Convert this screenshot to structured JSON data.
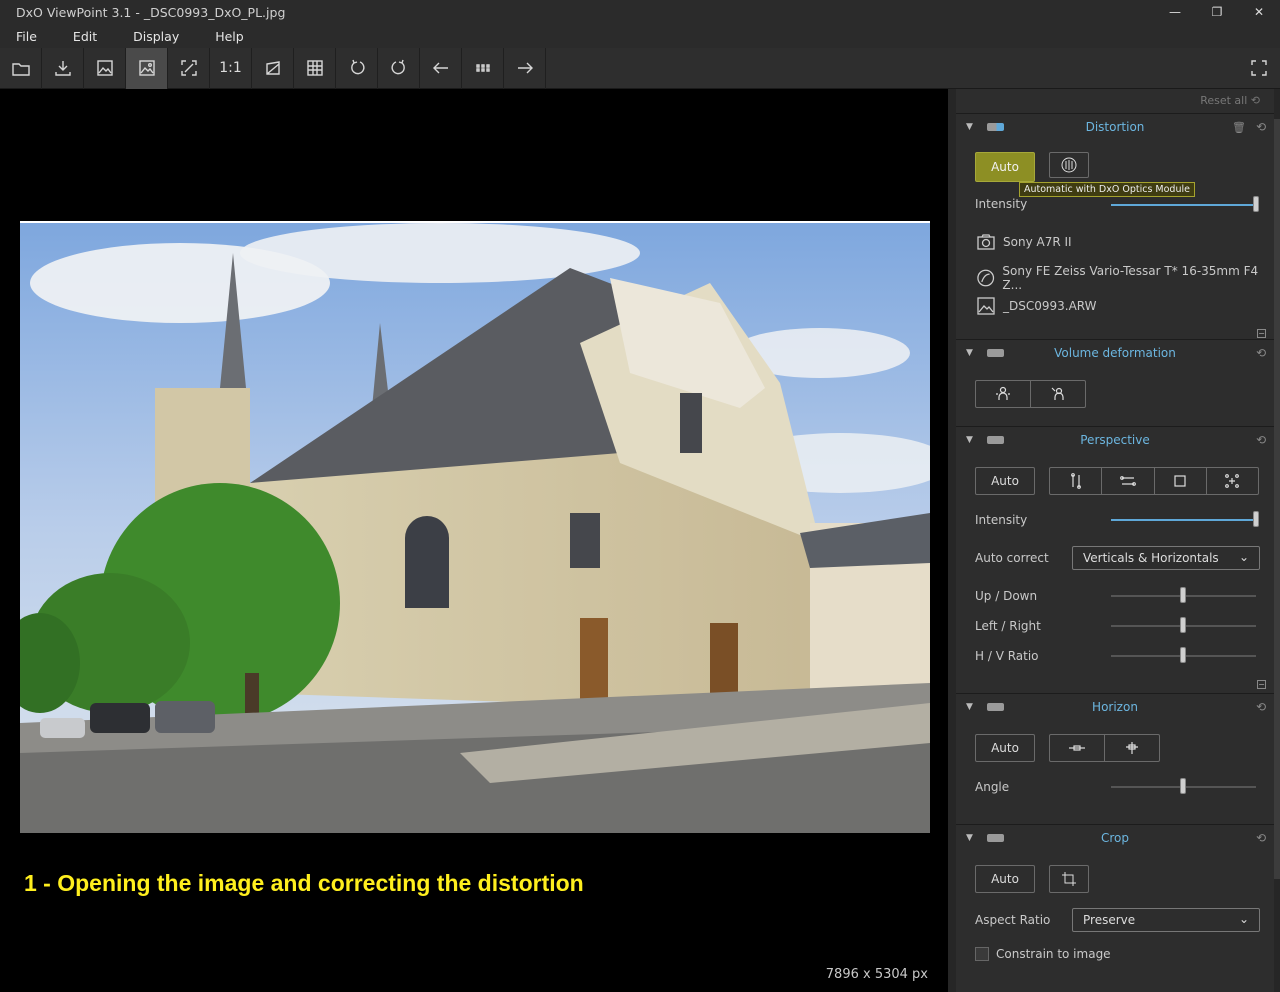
{
  "window": {
    "title": "DxO ViewPoint 3.1 - _DSC0993_DxO_PL.jpg"
  },
  "menu": [
    "File",
    "Edit",
    "Display",
    "Help"
  ],
  "toolbar": {
    "one_to_one": "1:1"
  },
  "viewer": {
    "caption": "1 - Opening the image and correcting the distortion",
    "dimensions": "7896 x 5304 px"
  },
  "panel": {
    "reset_all": "Reset all",
    "distortion": {
      "title": "Distortion",
      "auto": "Auto",
      "tooltip": "Automatic with DxO Optics Module",
      "intensity_label": "Intensity",
      "intensity": 1.0,
      "camera": "Sony A7R II",
      "lens": "Sony FE Zeiss Vario-Tessar T* 16-35mm F4 Z...",
      "file": "_DSC0993.ARW"
    },
    "volume": {
      "title": "Volume deformation"
    },
    "perspective": {
      "title": "Perspective",
      "auto": "Auto",
      "intensity_label": "Intensity",
      "intensity": 1.0,
      "auto_correct_label": "Auto correct",
      "auto_correct_value": "Verticals & Horizontals",
      "up_down_label": "Up / Down",
      "left_right_label": "Left / Right",
      "hv_ratio_label": "H / V Ratio",
      "up_down": 0.5,
      "left_right": 0.5,
      "hv_ratio": 0.5
    },
    "horizon": {
      "title": "Horizon",
      "auto": "Auto",
      "angle_label": "Angle",
      "angle": 0.5
    },
    "crop": {
      "title": "Crop",
      "auto": "Auto",
      "aspect_label": "Aspect Ratio",
      "aspect_value": "Preserve",
      "constrain_label": "Constrain to image"
    }
  }
}
